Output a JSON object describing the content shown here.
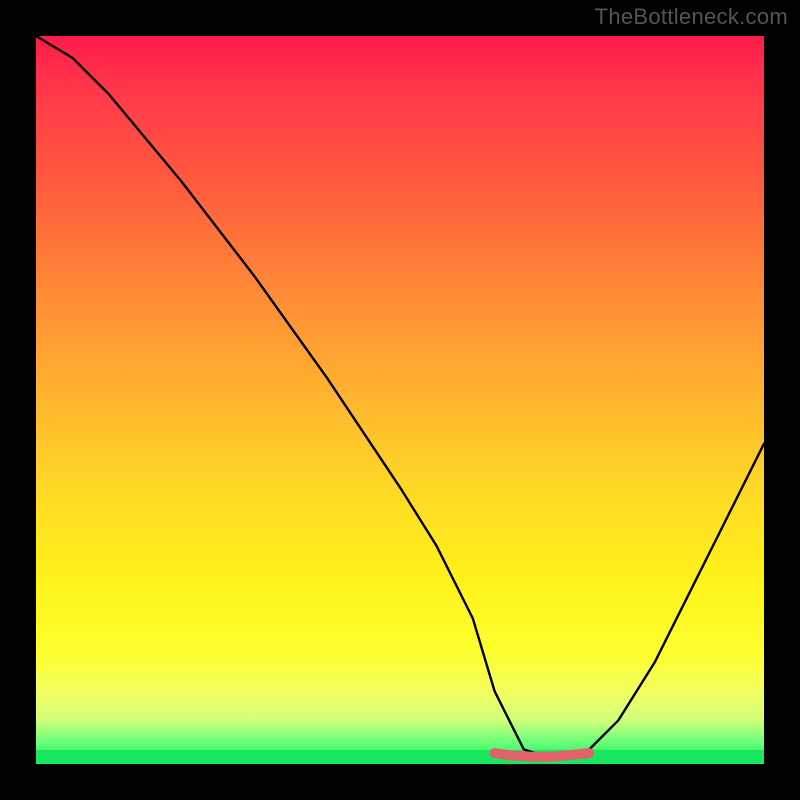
{
  "attribution": "TheBottleneck.com",
  "chart_data": {
    "type": "line",
    "title": "",
    "xlabel": "",
    "ylabel": "",
    "xlim": [
      0,
      100
    ],
    "ylim": [
      0,
      100
    ],
    "series": [
      {
        "name": "curve",
        "x": [
          0,
          5,
          10,
          20,
          30,
          40,
          50,
          55,
          60,
          63,
          67,
          70,
          73,
          76,
          80,
          85,
          90,
          95,
          100
        ],
        "values": [
          100,
          97,
          92,
          80,
          67,
          53,
          38,
          30,
          20,
          10,
          2,
          1,
          1,
          2,
          6,
          14,
          24,
          34,
          44
        ]
      },
      {
        "name": "optimal-marker",
        "x": [
          63,
          65,
          68,
          71,
          73,
          76
        ],
        "values": [
          1.5,
          1.2,
          1.0,
          1.0,
          1.2,
          1.5
        ]
      }
    ],
    "gradient_stops": [
      {
        "pos": 0.0,
        "color": "#ff1a4a"
      },
      {
        "pos": 0.35,
        "color": "#ff8a36"
      },
      {
        "pos": 0.75,
        "color": "#fff31a"
      },
      {
        "pos": 1.0,
        "color": "#18e860"
      }
    ]
  }
}
